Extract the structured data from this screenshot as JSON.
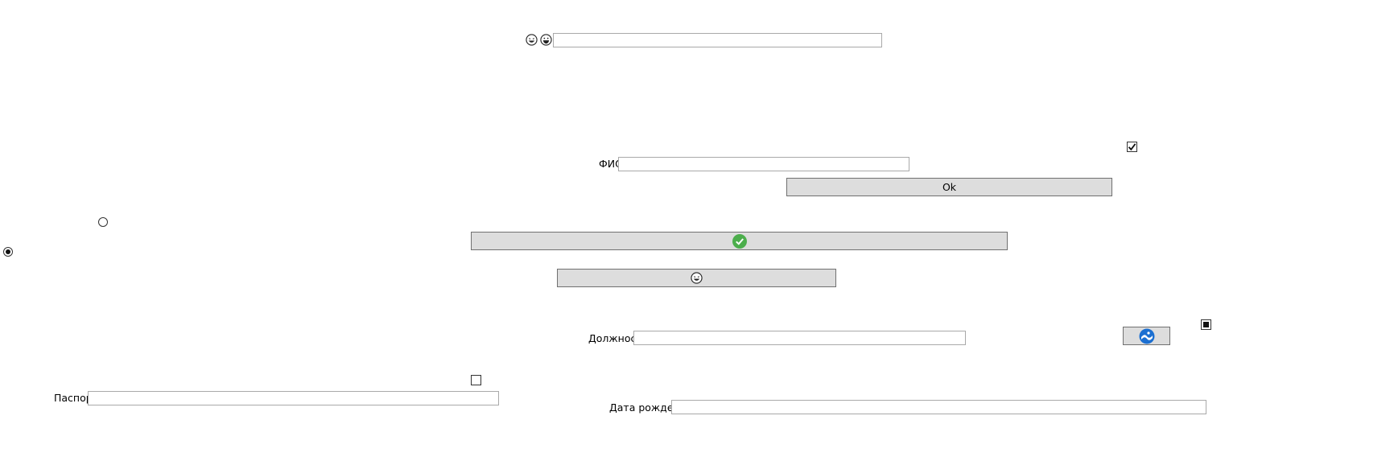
{
  "top_row": {
    "icons": [
      "laughing-face-icon",
      "grinning-face-icon"
    ],
    "input_value": ""
  },
  "form": {
    "fio_label": "ФИО",
    "fio_value": "",
    "ok_button": "Ok",
    "position_label": "Должность",
    "position_value": "",
    "passport_label": "Паспорт",
    "passport_value": "",
    "birthdate_label": "Дата рождения",
    "birthdate_value": ""
  },
  "buttons": {
    "confirm_icon": "green-check-circle-icon",
    "emoji_icon": "laughing-face-icon",
    "image_icon": "blue-circle-logo-icon"
  },
  "checkboxes": {
    "top_right_checked": true,
    "indeterminate": true,
    "left_unchecked": false
  },
  "radios": {
    "upper_selected": false,
    "lower_selected": true
  },
  "colors": {
    "button_bg": "#dddddd",
    "check_green": "#4cae4c",
    "logo_blue": "#1b6fd1"
  }
}
